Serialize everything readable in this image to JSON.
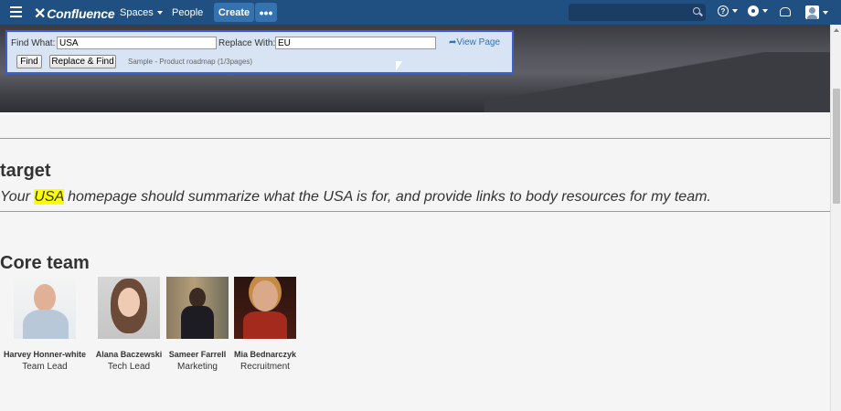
{
  "header": {
    "logo": "Confluence",
    "nav": {
      "spaces": "Spaces",
      "people": "People"
    },
    "create_label": "Create",
    "more_label": "•••",
    "search_placeholder": ""
  },
  "find_replace": {
    "find_label": "Find What:",
    "find_value": "USA",
    "replace_label": "Replace With:",
    "replace_value": "EU",
    "view_page": "View Page",
    "find_button": "Find",
    "replace_find_button": "Replace & Find",
    "status": "Sample - Product roadmap (1/3pages)"
  },
  "content": {
    "target_heading": "target",
    "intro_before": "Your ",
    "intro_highlight": "USA",
    "intro_after": " homepage should summarize what the USA is for, and provide links to body resources for my team.",
    "core_heading": "Core team",
    "team": [
      {
        "name": "Harvey Honner-white",
        "role": "Team Lead"
      },
      {
        "name": "Alana Baczewski",
        "role": "Tech Lead"
      },
      {
        "name": "Sameer Farrell",
        "role": "Marketing"
      },
      {
        "name": "Mia Bednarczyk",
        "role": "Recruitment"
      }
    ]
  },
  "colors": {
    "header": "#205081",
    "accent": "#3572b0",
    "highlight": "#ffff00",
    "panel_border": "#3b5fd0"
  }
}
